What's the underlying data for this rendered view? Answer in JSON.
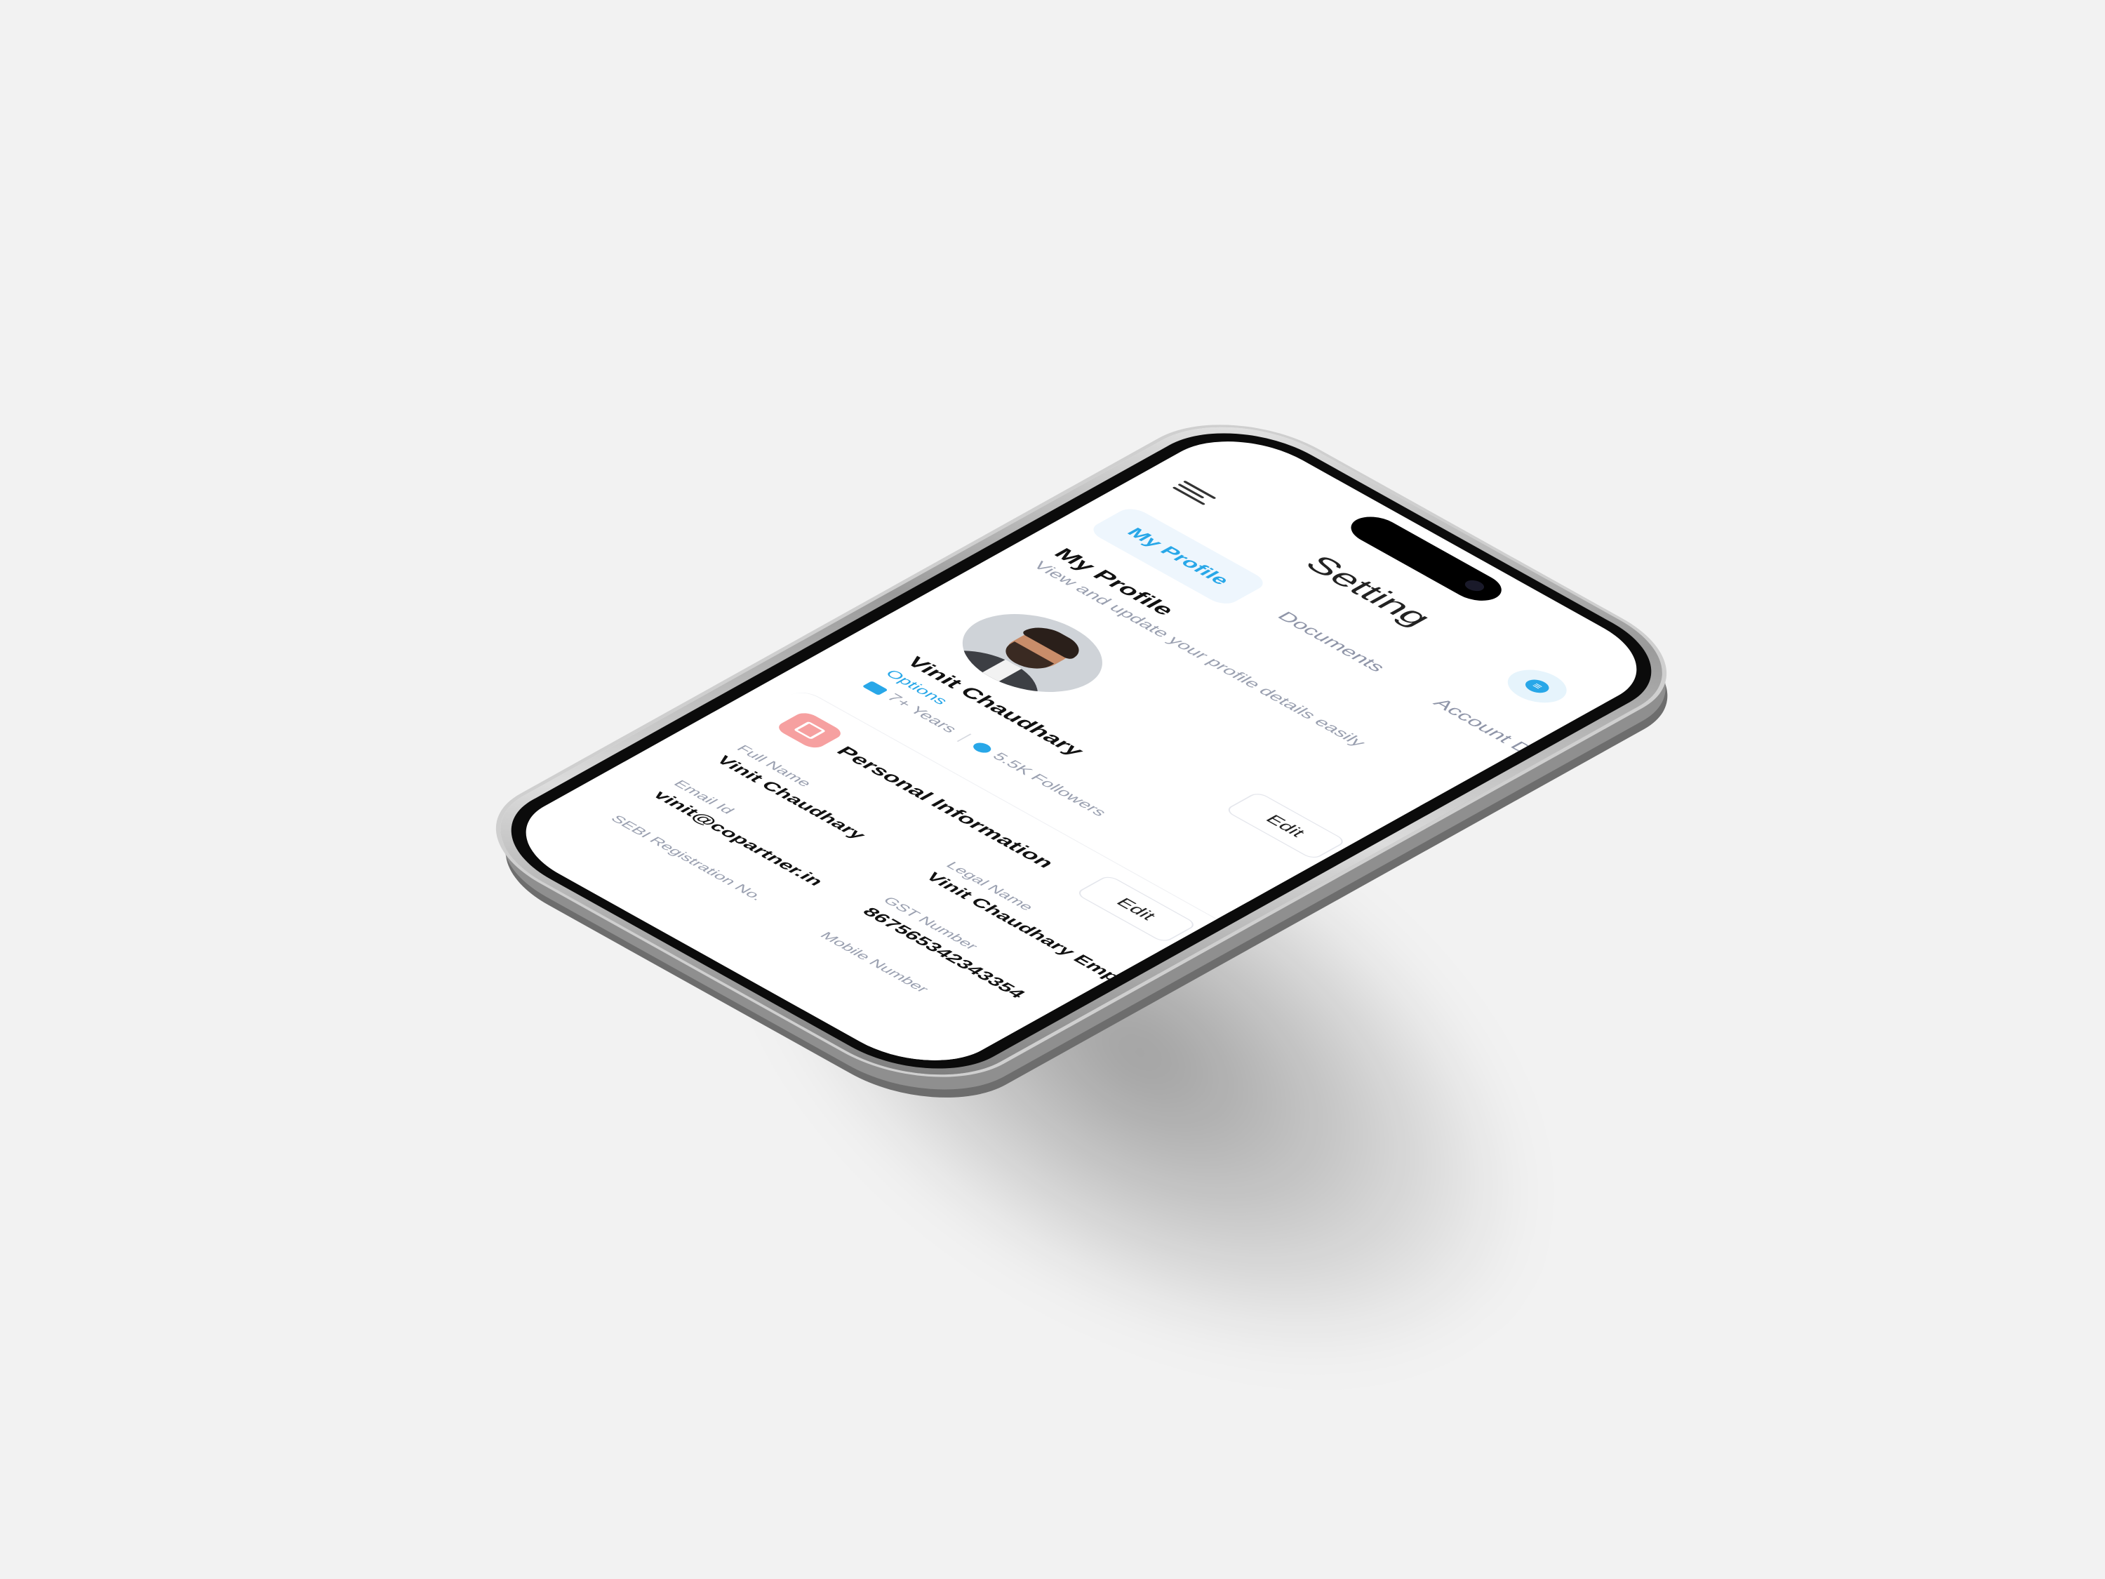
{
  "app": {
    "title": "Setting",
    "chat_icon": "chat-bubble-icon"
  },
  "tabs": [
    {
      "label": "My Profile",
      "active": true
    },
    {
      "label": "Documents",
      "active": false
    },
    {
      "label": "Account De",
      "active": false
    }
  ],
  "section": {
    "title": "My Profile",
    "subtitle": "View and update your profile details easily"
  },
  "profile": {
    "name": "Vinit Chaudhary",
    "category": "Options",
    "experience": "7+ Years",
    "followers": "5.5K Followers",
    "edit_label": "Edit"
  },
  "personal_info": {
    "title": "Personal Information",
    "edit_label": "Edit",
    "fields": [
      {
        "label": "Full Name",
        "value": "Vinit Chaudhary"
      },
      {
        "label": "Legal Name",
        "value": "Vinit Chaudhary Empire"
      },
      {
        "label": "Email Id",
        "value": "vinit@copartner.in"
      },
      {
        "label": "GST Number",
        "value": "867565342343354"
      },
      {
        "label": "SEBI Registration No.",
        "value": ""
      },
      {
        "label": "Mobile Number",
        "value": ""
      }
    ]
  },
  "colors": {
    "accent": "#28a7e8",
    "background": "#f2f2f2",
    "info_icon_bg": "#f6a0a0"
  }
}
